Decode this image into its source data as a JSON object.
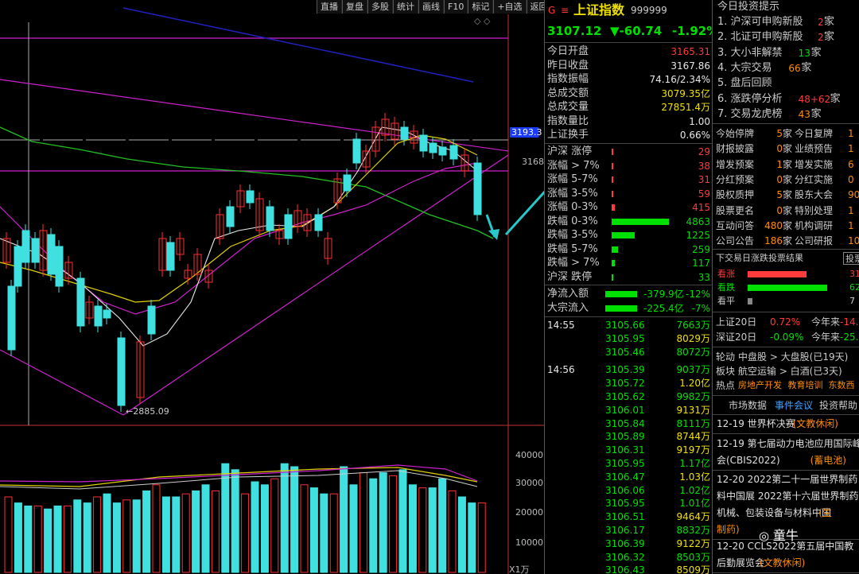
{
  "toolbar": [
    "直播",
    "复盘",
    "多股",
    "统计",
    "画线",
    "F10",
    "标记",
    "+自选",
    "返回"
  ],
  "chart": {
    "price_label": "3193.3",
    "level_label": "3168",
    "low_label": "2885.09",
    "volume_ticks": [
      "40000",
      "30000",
      "20000",
      "10000"
    ],
    "volume_unit": "X1万",
    "diamond": "◇ ◇"
  },
  "header": {
    "g": "G",
    "menu": "≡",
    "name": "上证指数",
    "code": "999999",
    "price": "3107.12",
    "change": "▼-60.74",
    "pct": "-1.92%"
  },
  "stats": [
    {
      "label": "今日开盘",
      "value": "3165.31",
      "color": "red"
    },
    {
      "label": "昨日收盘",
      "value": "3167.86",
      "color": "white"
    },
    {
      "label": "指数振幅",
      "value": "74.16/2.34%",
      "color": "white"
    },
    {
      "label": "总成交额",
      "value": "3079.35亿",
      "color": "yellow"
    },
    {
      "label": "总成交量",
      "value": "27851.4万",
      "color": "yellow"
    },
    {
      "label": "指数量比",
      "value": "1.00",
      "color": "white"
    },
    {
      "label": "上证换手",
      "value": "0.66%",
      "color": "white"
    }
  ],
  "dist": [
    {
      "label": "沪深 涨停",
      "value": "29",
      "color": "red",
      "bar": 0
    },
    {
      "label": "涨幅 > 7%",
      "value": "38",
      "color": "red",
      "bar": 0.01
    },
    {
      "label": "涨幅 5-7%",
      "value": "31",
      "color": "red",
      "bar": 0.01
    },
    {
      "label": "涨幅 3-5%",
      "value": "59",
      "color": "red",
      "bar": 0.01
    },
    {
      "label": "涨幅 0-3%",
      "value": "415",
      "color": "red",
      "bar": 0.05
    },
    {
      "label": "跌幅 0-3%",
      "value": "4863",
      "color": "green",
      "bar": 0.95
    },
    {
      "label": "跌幅 3-5%",
      "value": "1225",
      "color": "green",
      "bar": 0.38
    },
    {
      "label": "跌幅 5-7%",
      "value": "259",
      "color": "green",
      "bar": 0.1
    },
    {
      "label": "跌幅 > 7%",
      "value": "117",
      "color": "green",
      "bar": 0.05
    },
    {
      "label": "沪深 跌停",
      "value": "33",
      "color": "green",
      "bar": 0.01
    }
  ],
  "flows": [
    {
      "label": "净流入额",
      "value": "-379.9亿",
      "pct": "-12%"
    },
    {
      "label": "大宗流入",
      "value": "-225.4亿",
      "pct": "-7%"
    }
  ],
  "ticks_a": {
    "time": "14:55",
    "rows": [
      [
        "3105.66",
        "7663万",
        "green"
      ],
      [
        "3105.95",
        "8029万",
        "yellow"
      ],
      [
        "3105.46",
        "8072万",
        "green"
      ]
    ]
  },
  "ticks_b": {
    "time": "14:56",
    "rows": [
      [
        "3105.39",
        "9037万",
        "green"
      ],
      [
        "3105.72",
        "1.20亿",
        "yellow"
      ],
      [
        "3105.62",
        "9982万",
        "green"
      ],
      [
        "3106.01",
        "9131万",
        "yellow"
      ],
      [
        "3105.84",
        "8111万",
        "green"
      ],
      [
        "3105.89",
        "8744万",
        "yellow"
      ],
      [
        "3106.31",
        "9197万",
        "yellow"
      ],
      [
        "3105.95",
        "1.17亿",
        "green"
      ],
      [
        "3106.47",
        "1.03亿",
        "yellow"
      ],
      [
        "3106.06",
        "1.02亿",
        "green"
      ],
      [
        "3105.95",
        "1.01亿",
        "green"
      ],
      [
        "3106.51",
        "9464万",
        "yellow"
      ],
      [
        "3106.17",
        "8832万",
        "green"
      ],
      [
        "3106.39",
        "9122万",
        "yellow"
      ],
      [
        "3106.32",
        "8503万",
        "green"
      ],
      [
        "3106.43",
        "8509万",
        "yellow"
      ],
      [
        "3106.04",
        "9259万",
        "green"
      ]
    ]
  },
  "tips": {
    "title": "今日投资提示",
    "items": [
      {
        "text": "1. 沪深可申购新股",
        "num": "2",
        "unit": "家",
        "c": "red"
      },
      {
        "text": "2. 北证可申购新股",
        "num": "2",
        "unit": "家",
        "c": "red"
      },
      {
        "text": "3. 大小非解禁",
        "num": "13",
        "unit": "家",
        "c": "green"
      },
      {
        "text": "4. 大宗交易",
        "num": "66",
        "unit": "家",
        "c": "orange"
      },
      {
        "text": "5. 盘后回顾",
        "num": "",
        "unit": "",
        "c": "white"
      },
      {
        "text": "6. 涨跌停分析",
        "num": "48+62",
        "unit": "家",
        "c": "red"
      },
      {
        "text": "7. 交易龙虎榜",
        "num": "43",
        "unit": "家",
        "c": "orange"
      }
    ]
  },
  "events": [
    [
      "今始停牌",
      "5",
      "家",
      "今日复牌",
      "1"
    ],
    [
      "财报披露",
      "0",
      "家",
      "业绩预告",
      "1"
    ],
    [
      "增发预案",
      "1",
      "家",
      "增发实施",
      "6"
    ],
    [
      "分红预案",
      "0",
      "家",
      "分红实施",
      "0"
    ],
    [
      "股权质押",
      "5",
      "家",
      "股东大会",
      "90"
    ],
    [
      "股票更名",
      "0",
      "家",
      "特别处理",
      "1"
    ],
    [
      "互动问答",
      "480",
      "家",
      "机构调研",
      "1"
    ],
    [
      "公司公告",
      "186",
      "家",
      "公司研报",
      "100"
    ]
  ],
  "vote": {
    "title": "下交易日涨跌投票结果",
    "btn": "投票",
    "up": "看涨",
    "down": "看跌",
    "flat": "看平",
    "up_val": "31",
    "down_val": "62",
    "flat_val": "7"
  },
  "perf": [
    {
      "label": "上证20日",
      "v1": "0.72%",
      "c1": "red",
      "l2": "今年来",
      "v2": "-14.63"
    },
    {
      "label": "深证20日",
      "v1": "-0.09%",
      "c1": "green",
      "l2": "今年来",
      "v2": "-25.12"
    }
  ],
  "rotation": [
    {
      "a": "轮动",
      "b": "中盘股 > 大盘股(已19天)"
    },
    {
      "a": "板块",
      "b": "航空运输 > 白酒(已3天)"
    }
  ],
  "hot": {
    "label": "热点",
    "items": [
      "房地产开发",
      "教育培训",
      "东数西"
    ]
  },
  "news_tabs": [
    "市场数据",
    "事件会议",
    "投资帮助"
  ],
  "news": [
    {
      "line1": "12-19 世界杯决赛",
      "tag": "(文教休闲)"
    },
    {
      "line1": "12-19 第七届动力电池应用国际峰",
      "line2": "会(CBIS2022)",
      "tag": "(蓄电池)"
    },
    {
      "line1": "12-20 2022第二十一届世界制药",
      "line2": "料中国展 2022第十六届世界制药",
      "line3": "机械、包装设备与材料中国",
      "tag": "(生",
      "line4": "制药)"
    },
    {
      "line1": "12-20 CCLS2022第五届中国教",
      "line2": "后勤展览会",
      "tag": "(文教休闲)"
    }
  ],
  "watermark": "童牛"
}
